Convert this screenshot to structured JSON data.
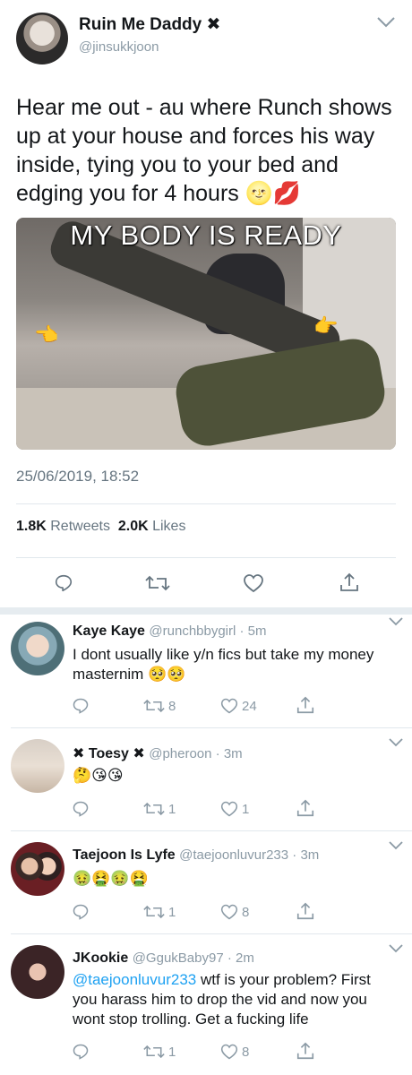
{
  "main_tweet": {
    "author_name": "Ruin Me Daddy ✖",
    "handle": "@jinsukkjoon",
    "text": "Hear me out - au where Runch shows up at your house and forces his way inside, tying you to your bed and edging you for 4 hours 🌝💋",
    "media_caption": "MY BODY IS READY",
    "timestamp": "25/06/2019, 18:52",
    "retweets_count": "1.8K",
    "retweets_label": "Retweets",
    "likes_count": "2.0K",
    "likes_label": "Likes"
  },
  "replies": [
    {
      "name": "Kaye Kaye",
      "meta": "@runchbbygirl · 5m",
      "text": "I dont usually like y/n fics but take my money masternim 🥺🥺",
      "retweets": "8",
      "likes": "24"
    },
    {
      "name": "✖ Toesy ✖",
      "meta": "@pheroon · 3m",
      "text": "🤔😘😘",
      "retweets": "1",
      "likes": "1"
    },
    {
      "name": "Taejoon Is Lyfe",
      "meta": "@taejoonluvur233 · 3m",
      "text": "🤢🤮🤢🤮",
      "retweets": "1",
      "likes": "8"
    },
    {
      "name": "JKookie",
      "meta": "@GgukBaby97 · 2m",
      "mention": "@taejoonluvur233",
      "text": " wtf is your problem? First you harass him to drop the vid and now you wont stop trolling. Get a fucking life",
      "retweets": "1",
      "likes": "8"
    }
  ],
  "colors": {
    "text": "#14171a",
    "muted": "#8b9aa5",
    "link": "#1da1f2",
    "divider": "#e1e8ed"
  },
  "icons": [
    "reply-icon",
    "retweet-icon",
    "like-icon",
    "share-icon",
    "chevron-down-icon"
  ]
}
